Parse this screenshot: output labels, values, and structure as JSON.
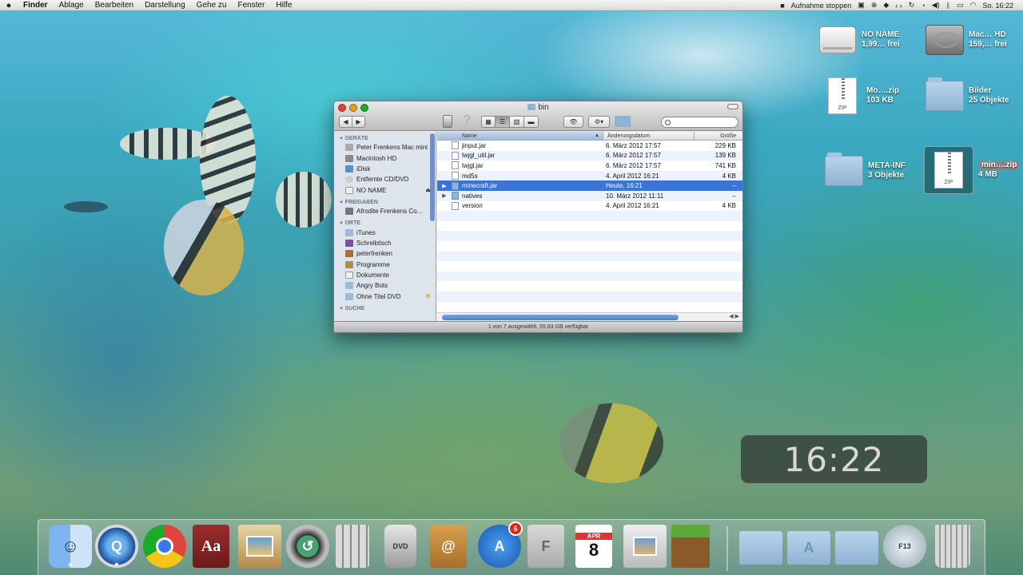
{
  "menubar": {
    "apple": "",
    "app": "Finder",
    "items": [
      "Ablage",
      "Bearbeiten",
      "Darstellung",
      "Gehe zu",
      "Fenster",
      "Hilfe"
    ],
    "recording": "Aufnahme stoppen",
    "time": "So. 16:22"
  },
  "desktop": {
    "icons": [
      {
        "name": "NO NAME",
        "info": "1,99… frei"
      },
      {
        "name": "Mac… HD",
        "info": "159,… frei"
      },
      {
        "name": "Mo….zip",
        "info": "103 KB"
      },
      {
        "name": "Bilder",
        "info": "25 Objekte"
      },
      {
        "name": "META-INF",
        "info": "3 Objekte"
      },
      {
        "name": "min….zip",
        "info": "4 MB"
      }
    ],
    "zip_label": "ZIP"
  },
  "window": {
    "title": "bin",
    "search_placeholder": "",
    "sidebar": {
      "sections": [
        {
          "title": "GERÄTE",
          "items": [
            "Peter Frenkens Mac mini",
            "Macintosh HD",
            "iDisk",
            "Entfernte CD/DVD",
            "NO NAME"
          ]
        },
        {
          "title": "FREIGABEN",
          "items": [
            "Afrodite Frenkens Co..."
          ]
        },
        {
          "title": "ORTE",
          "items": [
            "iTunes",
            "Schreibtisch",
            "peterfrenken",
            "Programme",
            "Dokumente",
            "Angry Bots",
            "Ohne Titel DVD"
          ]
        },
        {
          "title": "SUCHE",
          "items": []
        }
      ]
    },
    "columns": {
      "name": "Name",
      "date": "Änderungsdatum",
      "size": "Größe"
    },
    "files": [
      {
        "name": "jinput.jar",
        "date": "6. März 2012 17:57",
        "size": "229 KB",
        "folder": false
      },
      {
        "name": "lwjgl_util.jar",
        "date": "6. März 2012 17:57",
        "size": "139 KB",
        "folder": false
      },
      {
        "name": "lwjgl.jar",
        "date": "6. März 2012 17:57",
        "size": "741 KB",
        "folder": false
      },
      {
        "name": "md5s",
        "date": "4. April 2012 16:21",
        "size": "4 KB",
        "folder": false
      },
      {
        "name": "minecraft.jar",
        "date": "Heute, 16:21",
        "size": "--",
        "folder": true
      },
      {
        "name": "natives",
        "date": "10. März 2012 11:11",
        "size": "--",
        "folder": true
      },
      {
        "name": "version",
        "date": "4. April 2012 16:21",
        "size": "4 KB",
        "folder": false
      }
    ],
    "selected_index": 4,
    "status": "1 von 7 ausgewählt, 55,83 GB verfügbar"
  },
  "clock": {
    "time": "16:22"
  },
  "dock": {
    "badge": "6",
    "calendar_month": "APR",
    "calendar_day": "8",
    "dict_label": "Aa",
    "f13_label": "F13"
  },
  "colors": {
    "selection": "#3875d7",
    "sidebar": "#dde4ec",
    "badge": "#e2231a"
  }
}
